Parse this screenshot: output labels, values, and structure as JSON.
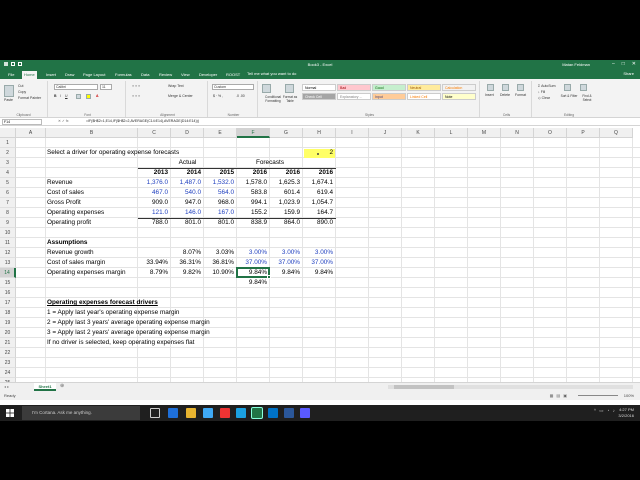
{
  "window": {
    "title": "Book3 - Excel",
    "user": "Matan Feldman"
  },
  "tabs": [
    "File",
    "Home",
    "Insert",
    "Draw",
    "Page Layout",
    "Formulas",
    "Data",
    "Review",
    "View",
    "Developer",
    "ROOST"
  ],
  "active_tab": "Home",
  "tell_me": "Tell me what you want to do",
  "share": "Share",
  "ribbon": {
    "clipboard": {
      "label": "Clipboard",
      "paste": "Paste",
      "cut": "Cut",
      "copy": "Copy",
      "format_painter": "Format Painter"
    },
    "font": {
      "label": "Font",
      "name": "Calibri",
      "size": "11"
    },
    "alignment": {
      "label": "Alignment",
      "wrap": "Wrap Text",
      "merge": "Merge & Center"
    },
    "number": {
      "label": "Number",
      "format": "Custom"
    },
    "styles": {
      "label": "Styles",
      "conditional": "Conditional Formatting",
      "format_table": "Format as Table",
      "cells": [
        {
          "name": "Normal",
          "bg": "#ffffff",
          "fg": "#000000"
        },
        {
          "name": "Bad",
          "bg": "#ffc7ce",
          "fg": "#9c0006"
        },
        {
          "name": "Good",
          "bg": "#c6efce",
          "fg": "#006100"
        },
        {
          "name": "Neutral",
          "bg": "#ffeb9c",
          "fg": "#9c5700"
        },
        {
          "name": "Calculation",
          "bg": "#f2f2f2",
          "fg": "#fa7d00"
        },
        {
          "name": "Check Cell",
          "bg": "#a5a5a5",
          "fg": "#ffffff"
        },
        {
          "name": "Explanatory ...",
          "bg": "#ffffff",
          "fg": "#7f7f7f"
        },
        {
          "name": "Input",
          "bg": "#ffcc99",
          "fg": "#3f3f76"
        },
        {
          "name": "Linked Cell",
          "bg": "#ffffff",
          "fg": "#fa7d00"
        },
        {
          "name": "Note",
          "bg": "#ffffcc",
          "fg": "#000000"
        }
      ]
    },
    "cells": {
      "label": "Cells",
      "insert": "Insert",
      "delete": "Delete",
      "format": "Format"
    },
    "editing": {
      "label": "Editing",
      "autosum": "AutoSum",
      "fill": "Fill",
      "clear": "Clear",
      "sort": "Sort & Filter",
      "find": "Find & Select"
    }
  },
  "formula_bar": {
    "name_box": "F14",
    "formula": "=IF($H$2=1,E14,IF($H$2=2,AVERAGE(C14:E14),AVERAGE(D14:E14)))"
  },
  "columns": [
    "A",
    "B",
    "C",
    "D",
    "E",
    "F",
    "G",
    "H",
    "I",
    "J",
    "K",
    "L",
    "M",
    "N",
    "O",
    "P",
    "Q"
  ],
  "rows": [
    "1",
    "2",
    "3",
    "4",
    "5",
    "6",
    "7",
    "8",
    "9",
    "10",
    "11",
    "12",
    "13",
    "14",
    "15",
    "16",
    "17",
    "18",
    "19",
    "20",
    "21",
    "22",
    "23",
    "24",
    "25"
  ],
  "selected": {
    "col": "F",
    "row": "14"
  },
  "sheet": {
    "prompt": "Select a driver for operating expense forecasts",
    "driver_value": "2",
    "actual_header": "Actual",
    "forecasts_header": "Forecasts",
    "years": [
      "2013",
      "2014",
      "2015",
      "2016",
      "2016",
      "2016"
    ],
    "financials": [
      {
        "label": "Revenue",
        "values": [
          "1,376.0",
          "1,487.0",
          "1,532.0",
          "1,578.0",
          "1,625.3",
          "1,674.1"
        ]
      },
      {
        "label": "Cost of sales",
        "values": [
          "467.0",
          "540.0",
          "564.0",
          "583.8",
          "601.4",
          "619.4"
        ]
      },
      {
        "label": "Gross Profit",
        "values": [
          "909.0",
          "947.0",
          "968.0",
          "994.1",
          "1,023.9",
          "1,054.7"
        ]
      },
      {
        "label": "Operating expenses",
        "values": [
          "121.0",
          "146.0",
          "167.0",
          "155.2",
          "159.9",
          "164.7"
        ]
      },
      {
        "label": "Operating profit",
        "values": [
          "788.0",
          "801.0",
          "801.0",
          "838.9",
          "864.0",
          "890.0"
        ]
      }
    ],
    "assumptions_title": "Assumptions",
    "assumptions": [
      {
        "label": "Revenue growth",
        "values": [
          "",
          "8.07%",
          "3.03%",
          "3.00%",
          "3.00%",
          "3.00%"
        ]
      },
      {
        "label": "Cost of sales margin",
        "values": [
          "33.94%",
          "36.31%",
          "36.81%",
          "37.00%",
          "37.00%",
          "37.00%"
        ]
      },
      {
        "label": "Operating expenses margin",
        "values": [
          "8.79%",
          "9.82%",
          "10.90%",
          "9.84%",
          "9.84%",
          "9.84%"
        ]
      }
    ],
    "f15_value": "9.84%",
    "drivers_title": "Operating expenses forecast drivers",
    "drivers": [
      "1 = Apply last year's operating expense margin",
      "2 = Apply last 3 years' average operating expense margin",
      "3 = Apply last 2 years' average operating expense margin",
      "If no driver is selected, keep operating expenses flat"
    ]
  },
  "sheet_tab": "Sheet1",
  "status": {
    "ready": "Ready",
    "zoom": "100%"
  },
  "taskbar": {
    "search": "I'm Cortana. Ask me anything.",
    "time": "4:27 PM",
    "date": "3/2/2016"
  },
  "colors": {
    "excel_green": "#217346",
    "input_blue": "#1f3fbf",
    "highlight_yellow": "#ffff66"
  }
}
